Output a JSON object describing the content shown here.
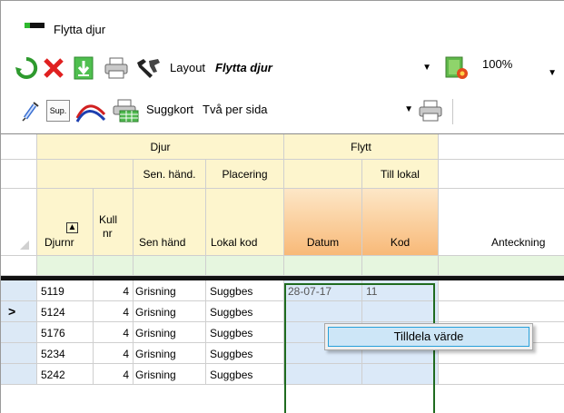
{
  "window": {
    "title": "Flytta djur"
  },
  "toolbar1": {
    "layout_label": "Layout",
    "layout_value": "Flytta djur",
    "zoom_value": "100%"
  },
  "toolbar2": {
    "sup_label": "Sup.",
    "card_label": "Suggkort",
    "card_value": "Två per sida"
  },
  "grid": {
    "group_headers": {
      "djur": "Djur",
      "flytt": "Flytt"
    },
    "sub_headers": {
      "sen_hand": "Sen. händ.",
      "placering": "Placering",
      "till_lokal": "Till lokal"
    },
    "columns": {
      "djurnr": "Djurnr",
      "kull_1": "Kull",
      "kull_2": "nr",
      "sen_hand": "Sen händ",
      "lokal_kod": "Lokal kod",
      "datum": "Datum",
      "kod": "Kod",
      "anteckning": "Anteckning"
    },
    "sort_indicator": "▲",
    "current_row_marker": ">",
    "rows": [
      {
        "djurnr": "5119",
        "kull": "4",
        "sen_hand": "Grisning",
        "lokal": "Suggbes",
        "datum": "28-07-17",
        "kod": "11"
      },
      {
        "djurnr": "5124",
        "kull": "4",
        "sen_hand": "Grisning",
        "lokal": "Suggbes",
        "datum": "",
        "kod": ""
      },
      {
        "djurnr": "5176",
        "kull": "4",
        "sen_hand": "Grisning",
        "lokal": "Suggbes",
        "datum": "",
        "kod": ""
      },
      {
        "djurnr": "5234",
        "kull": "4",
        "sen_hand": "Grisning",
        "lokal": "Suggbes",
        "datum": "",
        "kod": ""
      },
      {
        "djurnr": "5242",
        "kull": "4",
        "sen_hand": "Grisning",
        "lokal": "Suggbes",
        "datum": "",
        "kod": ""
      }
    ]
  },
  "context_menu": {
    "item": "Tilldela värde"
  }
}
